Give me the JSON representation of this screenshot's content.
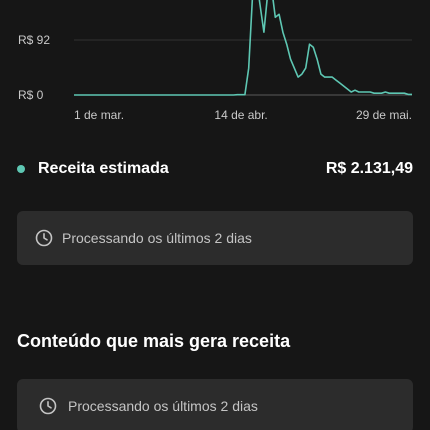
{
  "chart_data": {
    "type": "area",
    "y_tick_labels": [
      "R$ 92",
      "R$ 0"
    ],
    "y_ticks": [
      92,
      0
    ],
    "x_tick_labels": [
      "1 de mar.",
      "14 de abr.",
      "29 de mai."
    ],
    "x_tick_days": [
      0,
      44,
      89
    ],
    "x_unit": "days since 1 de mar.",
    "ylim": [
      0,
      160
    ],
    "grid": true,
    "color": "#5ec7b3",
    "values": [
      0,
      0,
      0,
      0,
      0,
      0,
      0,
      0,
      0,
      0,
      0,
      0,
      0,
      0,
      0,
      0,
      0,
      0,
      0,
      0,
      0,
      0,
      0,
      0,
      0,
      0,
      0,
      0,
      0,
      0,
      0,
      0,
      0,
      0,
      0,
      0,
      0,
      0,
      0,
      0,
      0,
      0,
      0,
      0.5,
      0.5,
      0.5,
      45,
      165,
      195,
      150,
      105,
      170,
      180,
      130,
      135,
      105,
      85,
      60,
      45,
      30,
      35,
      45,
      85,
      80,
      60,
      35,
      30,
      30,
      30,
      25,
      20,
      15,
      10,
      5,
      8,
      5,
      5,
      5,
      5,
      3,
      3,
      3,
      5,
      3,
      3,
      3,
      3,
      3,
      1,
      1
    ]
  },
  "summary": {
    "label": "Receita estimada",
    "value": "R$ 2.131,49",
    "dot_color": "#5ec7b3"
  },
  "processing_card_1": {
    "icon": "clock-icon",
    "text": "Processando os últimos 2 dias"
  },
  "top_content": {
    "title": "Conteúdo que mais gera receita"
  },
  "processing_card_2": {
    "icon": "clock-icon",
    "text": "Processando os últimos 2 dias"
  }
}
